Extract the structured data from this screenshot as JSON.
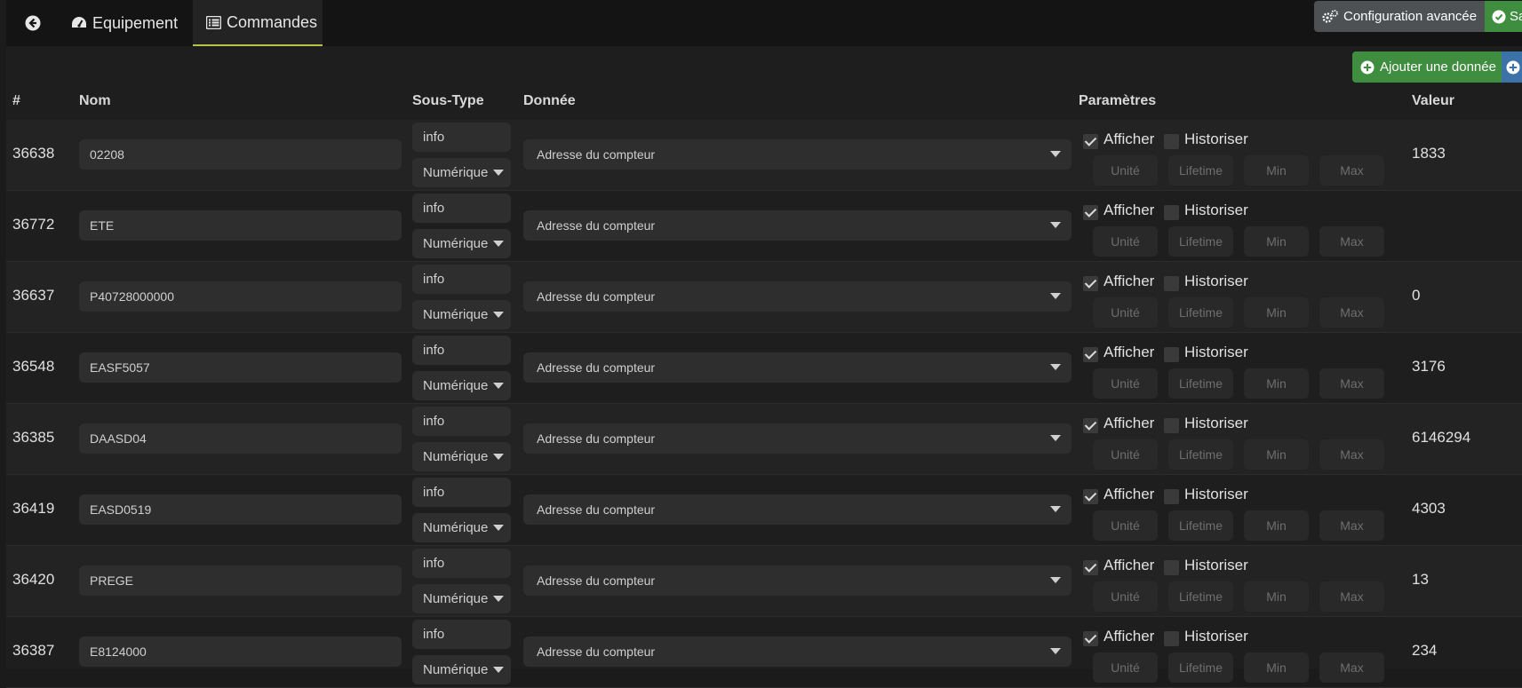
{
  "tabs": {
    "equipement": "Equipement",
    "commandes": "Commandes"
  },
  "actions": {
    "config": "Configuration avancée",
    "save": "Sa",
    "add": "Ajouter une donnée"
  },
  "columns": {
    "id": "#",
    "nom": "Nom",
    "sous_type": "Sous-Type",
    "donnee": "Donnée",
    "parametres": "Paramètres",
    "valeur": "Valeur"
  },
  "labels": {
    "afficher": "Afficher",
    "historiser": "Historiser"
  },
  "placeholders": {
    "unite": "Unité",
    "lifetime": "Lifetime",
    "min": "Min",
    "max": "Max"
  },
  "rows": [
    {
      "id": "36638",
      "nom": "02208",
      "type": "info",
      "subtype": "Numérique",
      "donnee": "Adresse du compteur",
      "afficher": true,
      "historiser": false,
      "valeur": "1833"
    },
    {
      "id": "36772",
      "nom": "ETE",
      "type": "info",
      "subtype": "Numérique",
      "donnee": "Adresse du compteur",
      "afficher": true,
      "historiser": false,
      "valeur": ""
    },
    {
      "id": "36637",
      "nom": "P40728000000",
      "type": "info",
      "subtype": "Numérique",
      "donnee": "Adresse du compteur",
      "afficher": true,
      "historiser": false,
      "valeur": "0"
    },
    {
      "id": "36548",
      "nom": "EASF5057",
      "type": "info",
      "subtype": "Numérique",
      "donnee": "Adresse du compteur",
      "afficher": true,
      "historiser": false,
      "valeur": "3176"
    },
    {
      "id": "36385",
      "nom": "DAASD04",
      "type": "info",
      "subtype": "Numérique",
      "donnee": "Adresse du compteur",
      "afficher": true,
      "historiser": false,
      "valeur": "6146294"
    },
    {
      "id": "36419",
      "nom": "EASD0519",
      "type": "info",
      "subtype": "Numérique",
      "donnee": "Adresse du compteur",
      "afficher": true,
      "historiser": false,
      "valeur": "4303"
    },
    {
      "id": "36420",
      "nom": "PREGE",
      "type": "info",
      "subtype": "Numérique",
      "donnee": "Adresse du compteur",
      "afficher": true,
      "historiser": false,
      "valeur": "13"
    },
    {
      "id": "36387",
      "nom": "E8124000",
      "type": "info",
      "subtype": "Numérique",
      "donnee": "Adresse du compteur",
      "afficher": true,
      "historiser": false,
      "valeur": "234"
    }
  ]
}
